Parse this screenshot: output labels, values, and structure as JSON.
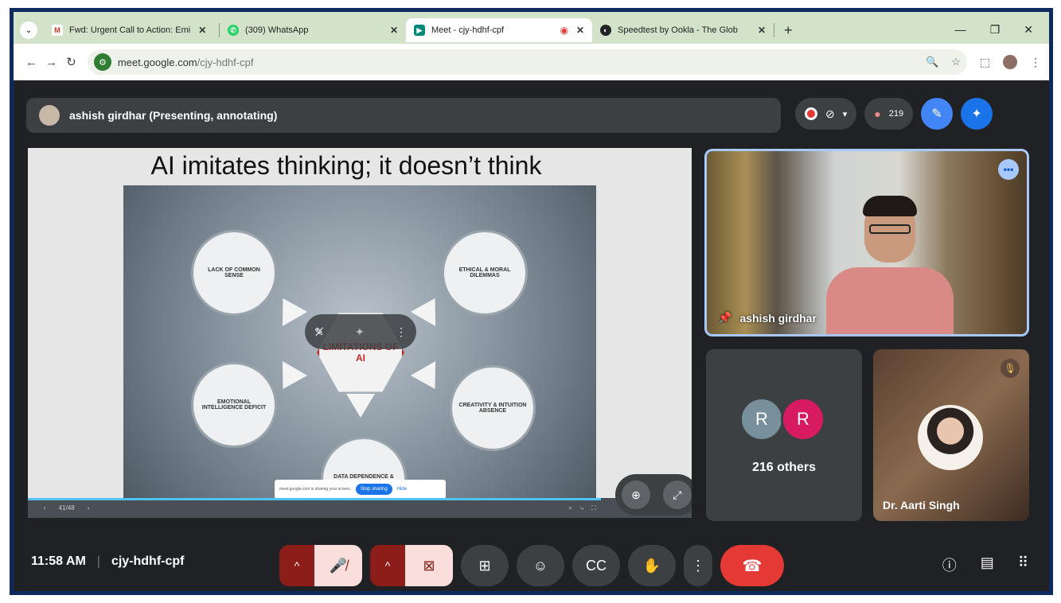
{
  "browser": {
    "tabs": [
      {
        "title": "Fwd: Urgent Call to Action: Emi",
        "icon": "gmail-icon",
        "active": false
      },
      {
        "title": "(309) WhatsApp",
        "icon": "whatsapp-icon",
        "active": false
      },
      {
        "title": "Meet - cjy-hdhf-cpf",
        "icon": "meet-icon",
        "active": true
      },
      {
        "title": "Speedtest by Ookla - The Glob",
        "icon": "speedtest-icon",
        "active": false
      }
    ],
    "new_tab_label": "+",
    "url_host": "meet.google.com",
    "url_path": "/cjy-hdhf-cpf"
  },
  "meet": {
    "presenter_label": "ashish girdhar (Presenting, annotating)",
    "participants_count": "219",
    "slide": {
      "title": "AI imitates thinking; it doesn’t think",
      "nodes": [
        "LACK OF COMMON SENSE",
        "ETHICAL & MORAL DILEMMAS",
        "EMOTIONAL INTELLIGENCE DEFICIT",
        "CREATIVITY & INTUITION ABSENCE",
        "DATA DEPENDENCE & BIAS"
      ],
      "center": "LIMITATIONS OF AI",
      "share_notice": "meet.google.com is sharing your screen.",
      "stop_sharing": "Stop sharing",
      "hide": "Hide",
      "page": "41/48"
    },
    "tiles": {
      "main_speaker": "ashish girdhar",
      "others_avatars": [
        "R",
        "R"
      ],
      "others_count": "216 others",
      "third_name": "Dr. Aarti Singh"
    },
    "time": "11:58 AM",
    "meeting_code": "cjy-hdhf-cpf",
    "colors": {
      "background": "#202124",
      "hangup": "#e53935",
      "avatar_1": "#78909c",
      "avatar_2": "#d81b60",
      "accent": "#a8c7fa"
    }
  }
}
